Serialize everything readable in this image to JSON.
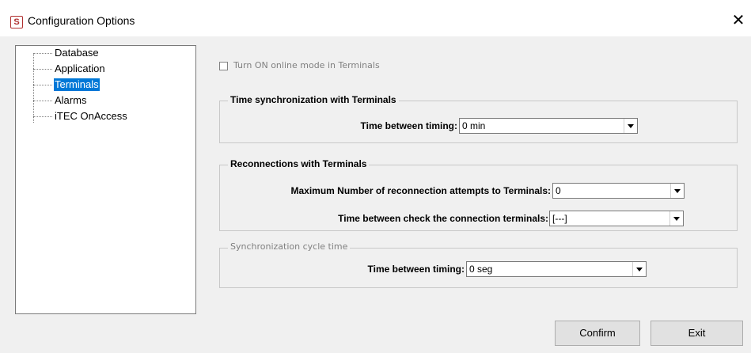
{
  "window": {
    "title": "Configuration Options",
    "app_icon": "app-logo-icon",
    "close_icon": "close-icon"
  },
  "tree": {
    "items": [
      {
        "label": "Database",
        "selected": false
      },
      {
        "label": "Application",
        "selected": false
      },
      {
        "label": "Terminals",
        "selected": true
      },
      {
        "label": "Alarms",
        "selected": false
      },
      {
        "label": "iTEC OnAccess",
        "selected": false
      }
    ]
  },
  "online_mode": {
    "label": "Turn ON online mode in Terminals",
    "checked": false,
    "enabled": false
  },
  "time_sync": {
    "title": "Time synchronization with Terminals",
    "timing_label": "Time between timing:",
    "timing_value": "0 min"
  },
  "reconnections": {
    "title": "Reconnections with Terminals",
    "max_attempts_label": "Maximum Number of reconnection attempts to Terminals:",
    "max_attempts_value": "0",
    "check_label": "Time between check the connection terminals:",
    "check_value": "[---]"
  },
  "sync_cycle": {
    "title": "Synchronization cycle time",
    "timing_label": "Time between timing:",
    "timing_value": "0 seg"
  },
  "buttons": {
    "confirm": "Confirm",
    "exit": "Exit"
  },
  "colors": {
    "selection": "#0078d7",
    "background": "#f0f0f0",
    "disabled_text": "#808080"
  }
}
